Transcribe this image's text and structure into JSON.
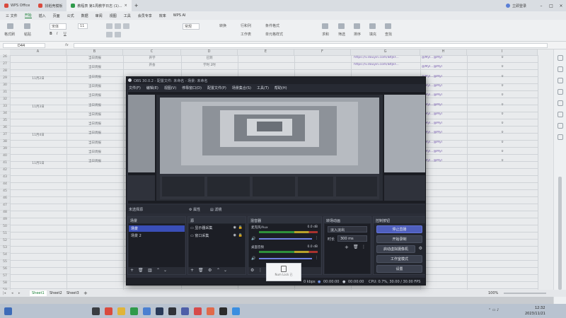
{
  "wps": {
    "tabs": [
      {
        "label": "WPS Office",
        "color": "#d94a3d"
      },
      {
        "label": "找稻壳模板",
        "color": "#d94a3d"
      },
      {
        "label": "教程表 第1周教学日志 (1)...",
        "color": "#2f9a4a"
      }
    ],
    "login_label": "立即登录",
    "menus": [
      "三 文件",
      "开始",
      "插入",
      "页面",
      "公式",
      "数据",
      "审阅",
      "视图",
      "工具",
      "会员专享",
      "效率",
      "WPS AI"
    ],
    "active_menu": "开始",
    "ribbon_labels": [
      "格式刷",
      "粘贴",
      "宋体",
      "11",
      "常规",
      "转换",
      "行和列",
      "工作表",
      "条件格式",
      "单元格样式",
      "求和",
      "筛选",
      "排序",
      "填充",
      "查找"
    ],
    "name_box": "D44",
    "fx": "fx",
    "columns": [
      "A",
      "B",
      "C",
      "D",
      "E",
      "F",
      "G",
      "H",
      "I"
    ],
    "rows": [
      "26",
      "27",
      "28",
      "29",
      "30",
      "31",
      "32",
      "33",
      "34",
      "35",
      "36",
      "37",
      "38",
      "39",
      "40",
      "41",
      "42",
      "43",
      "44",
      "45",
      "46",
      "47",
      "48",
      "49",
      "50",
      "51",
      "52",
      "53",
      "54",
      "55",
      "56",
      "57",
      "58",
      "59",
      "60"
    ],
    "dates": [
      "11月2日",
      "11月3日",
      "11月4日",
      "11月5日"
    ],
    "b_cells": [
      "当日周报",
      "当日周报",
      "当日周报",
      "当日周报",
      "当日周报",
      "当日周报",
      "当日周报",
      "当日周报",
      "当日周报",
      "当日周报",
      "当日周报",
      "当日周报"
    ],
    "c_cells": [
      "开学",
      "开会"
    ],
    "d_cells": [
      "已到",
      "学时 2时"
    ],
    "g_cells": [
      "https://v.douyin.com/iBtjkF...",
      "https://v.douyin.com/iBtjkF..."
    ],
    "h_cells": [
      "@Myl...@Myl",
      "@Myl...@Myl",
      "@Myl...@Myl",
      "@Myl...@Myl",
      "@Myl...@Myl",
      "@Myl...@Myl",
      "@Myl...@Myl",
      "@Myl...@Myl",
      "@Myl...@Myl",
      "@Myl...@Myl",
      "@Myl...@Myl",
      "@Myl...@Myl"
    ],
    "i_cells": [
      "0",
      "0",
      "0",
      "0",
      "0",
      "0",
      "0",
      "0",
      "0",
      "0",
      "0",
      "0"
    ],
    "sheet_tabs": [
      "Sheet1",
      "Sheet2",
      "Sheet3",
      "+"
    ],
    "zoom": "100%"
  },
  "obs": {
    "title": "OBS 30.0.2 - 配置文件: 未命名 - 场景: 未命名",
    "menus": [
      "文件(F)",
      "编辑(E)",
      "视图(V)",
      "停靠窗口(D)",
      "配置文件(P)",
      "场景集合(S)",
      "工具(T)",
      "帮助(H)"
    ],
    "source_label": "未选择源",
    "properties_label": "属性",
    "filters_label": "滤镜",
    "docks": {
      "scenes": {
        "title": "场景",
        "items": [
          "场景",
          "场景 2"
        ],
        "selected": 0
      },
      "sources": {
        "title": "源",
        "items": [
          "显示器采集",
          "窗口采集"
        ]
      },
      "mixer": {
        "title": "混音器",
        "channels": [
          {
            "name": "桌面音频",
            "db": "0.0 dB"
          },
          {
            "name": "麦克风/Aux",
            "db": "0.0 dB"
          }
        ]
      },
      "transitions": {
        "title": "转场动画",
        "transition": "淡入淡出",
        "duration_label": "时长",
        "duration": "300 ms"
      },
      "controls": {
        "title": "控制按钮",
        "buttons": [
          "停止直播",
          "开始录制",
          "启动虚拟摄像机",
          "工作室模式",
          "设置"
        ]
      }
    },
    "status": {
      "kbps": "0 kbps",
      "stream_time": "00:00:00",
      "rec_time": "00:00:00",
      "cpu": "CPU: 0.7%, 30.00 / 30.00 FPS"
    }
  },
  "lock_popup": {
    "label": "Num Lock 已"
  },
  "taskbar": {
    "time": "12:32",
    "date": "2023/11/21"
  }
}
